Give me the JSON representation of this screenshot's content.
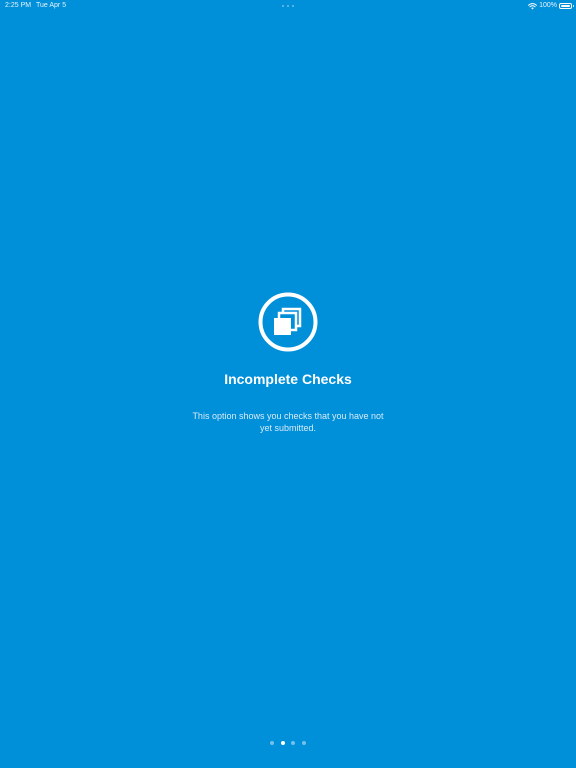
{
  "status_bar": {
    "time": "2:25 PM",
    "date": "Tue Apr 5",
    "battery_percent": "100%",
    "battery_level": 1.0
  },
  "onboarding": {
    "icon": "stacked-pages-icon",
    "title": "Incomplete Checks",
    "description": "This option shows you checks that you have not yet submitted."
  },
  "pagination": {
    "total_pages": 4,
    "current_page": 2
  },
  "colors": {
    "background": "#008fd9",
    "text": "#ffffff"
  }
}
